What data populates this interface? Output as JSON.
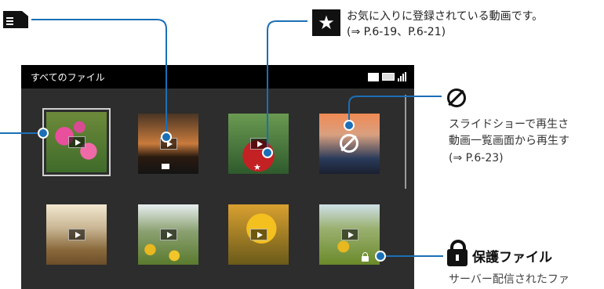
{
  "screen": {
    "title": "すべてのファイル",
    "status_icons": [
      "sd-card-icon",
      "battery-icon",
      "signal-icon"
    ]
  },
  "thumbnails": [
    {
      "name": "cosmos",
      "selected": true,
      "badge": "none"
    },
    {
      "name": "sunset",
      "selected": false,
      "badge": "sd-card-icon"
    },
    {
      "name": "red-shrine",
      "selected": false,
      "badge": "star-icon"
    },
    {
      "name": "sunrise",
      "selected": false,
      "badge": "not-playable-icon"
    },
    {
      "name": "field",
      "selected": false,
      "badge": "none"
    },
    {
      "name": "sunflower-field",
      "selected": false,
      "badge": "none"
    },
    {
      "name": "sunflower-closeup",
      "selected": false,
      "badge": "none"
    },
    {
      "name": "sunflower-sky",
      "selected": false,
      "badge": "lock-icon"
    }
  ],
  "annotations": {
    "favorite": {
      "icon": "star-icon",
      "line1": "お気に入りに登録されている動画です。",
      "line2": "(⇒ P.6-19、P.6-21)"
    },
    "not_playable": {
      "icon": "not-playable-icon",
      "line1": "スライドショーで再生さ",
      "line2": "動画一覧画面から再生す",
      "line3": "(⇒ P.6-23)"
    },
    "protected": {
      "icon": "lock-icon",
      "title": "保護ファイル",
      "desc": "サーバー配信されたファ"
    },
    "sd_card": {
      "icon": "sd-card-icon"
    }
  },
  "colors": {
    "screen_bg": "#2d2d2d",
    "topbar_bg": "#000000",
    "callout_line": "#1b6fb6"
  }
}
